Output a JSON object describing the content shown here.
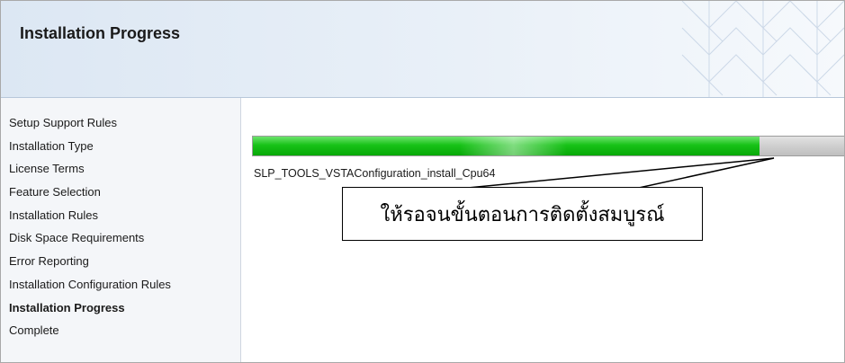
{
  "window": {
    "title": "Installation Progress"
  },
  "sidebar": {
    "items": [
      {
        "label": "Setup Support Rules",
        "active": false
      },
      {
        "label": "Installation Type",
        "active": false
      },
      {
        "label": "License Terms",
        "active": false
      },
      {
        "label": "Feature Selection",
        "active": false
      },
      {
        "label": "Installation Rules",
        "active": false
      },
      {
        "label": "Disk Space Requirements",
        "active": false
      },
      {
        "label": "Error Reporting",
        "active": false
      },
      {
        "label": "Installation Configuration Rules",
        "active": false
      },
      {
        "label": "Installation Progress",
        "active": true
      },
      {
        "label": "Complete",
        "active": false
      }
    ]
  },
  "progress": {
    "fraction": 0.855,
    "status_text": "SLP_TOOLS_VSTAConfiguration_install_Cpu64",
    "fill_color": "#17c217",
    "track_color": "#cfcfcf"
  },
  "annotation": {
    "text": "ให้รอจนขั้นตอนการติดตั้งสมบูรณ์"
  }
}
